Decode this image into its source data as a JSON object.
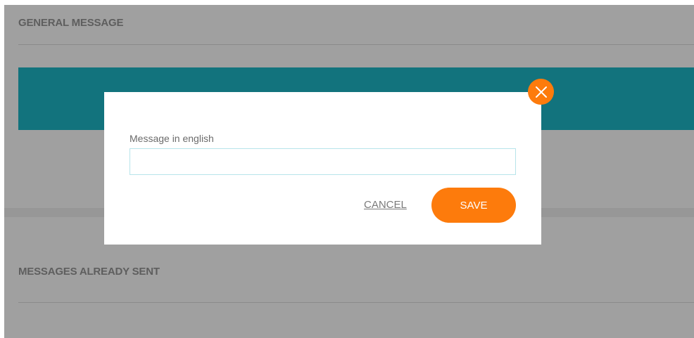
{
  "sections": {
    "general_title": "GENERAL MESSAGE",
    "sent_title": "MESSAGES ALREADY SENT"
  },
  "modal": {
    "field_label": "Message in english",
    "input_value": "",
    "cancel_label": "CANCEL",
    "save_label": "SAVE",
    "close_icon": "close-icon"
  },
  "colors": {
    "accent": "#fd7b0c",
    "teal": "#12737d",
    "overlay": "#a0a0a0"
  }
}
